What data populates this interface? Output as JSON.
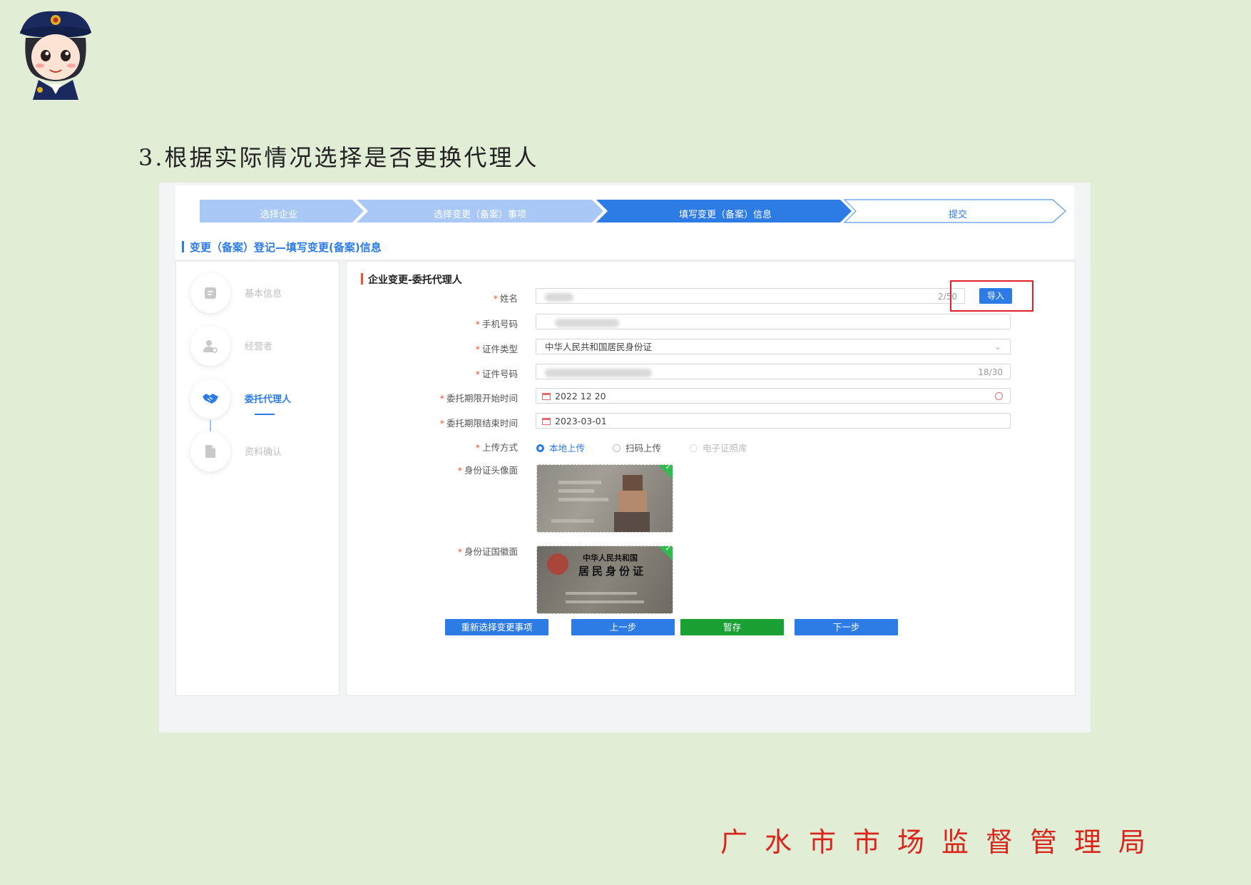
{
  "slide": {
    "step_title": "3.根据实际情况选择是否更换代理人",
    "footer": "广水市市场监督管理局"
  },
  "steps": [
    {
      "label": "选择企业",
      "state": "done"
    },
    {
      "label": "选择变更（备案）事项",
      "state": "done"
    },
    {
      "label": "填写变更（备案）信息",
      "state": "active"
    },
    {
      "label": "提交",
      "state": "todo"
    }
  ],
  "page_heading": "变更（备案）登记—填写变更(备案)信息",
  "sidebar": {
    "items": [
      {
        "label": "基本信息",
        "active": false
      },
      {
        "label": "经营者",
        "active": false
      },
      {
        "label": "委托代理人",
        "active": true
      },
      {
        "label": "资料确认",
        "active": false
      }
    ]
  },
  "form": {
    "section_title": "企业变更-委托代理人",
    "import_label": "导入",
    "fields": {
      "name": {
        "label": "姓名",
        "count": "2/50"
      },
      "phone": {
        "label": "手机号码"
      },
      "id_type": {
        "label": "证件类型",
        "value": "中华人民共和国居民身份证"
      },
      "id_number": {
        "label": "证件号码",
        "count": "18/30"
      },
      "start_date": {
        "label": "委托期限开始时间",
        "value": "2022 12 20"
      },
      "end_date": {
        "label": "委托期限结束时间",
        "value": "2023-03-01"
      },
      "upload_method": {
        "label": "上传方式",
        "options": [
          "本地上传",
          "扫码上传",
          "电子证照库"
        ],
        "selected": "本地上传"
      },
      "id_front": {
        "label": "身份证头像面"
      },
      "id_back": {
        "label": "身份证国徽面",
        "card_title1": "中华人民共和国",
        "card_title2": "居民身份证"
      }
    },
    "buttons": {
      "reselect": "重新选择变更事项",
      "prev": "上一步",
      "save": "暂存",
      "next": "下一步"
    }
  },
  "colors": {
    "primary": "#2d7be5",
    "step_done": "#a9c8f6",
    "success": "#1aa035",
    "required": "#e8542e",
    "annotation": "#e0212a",
    "footer_text": "#d9261c",
    "slide_bg": "#e2edd6"
  }
}
